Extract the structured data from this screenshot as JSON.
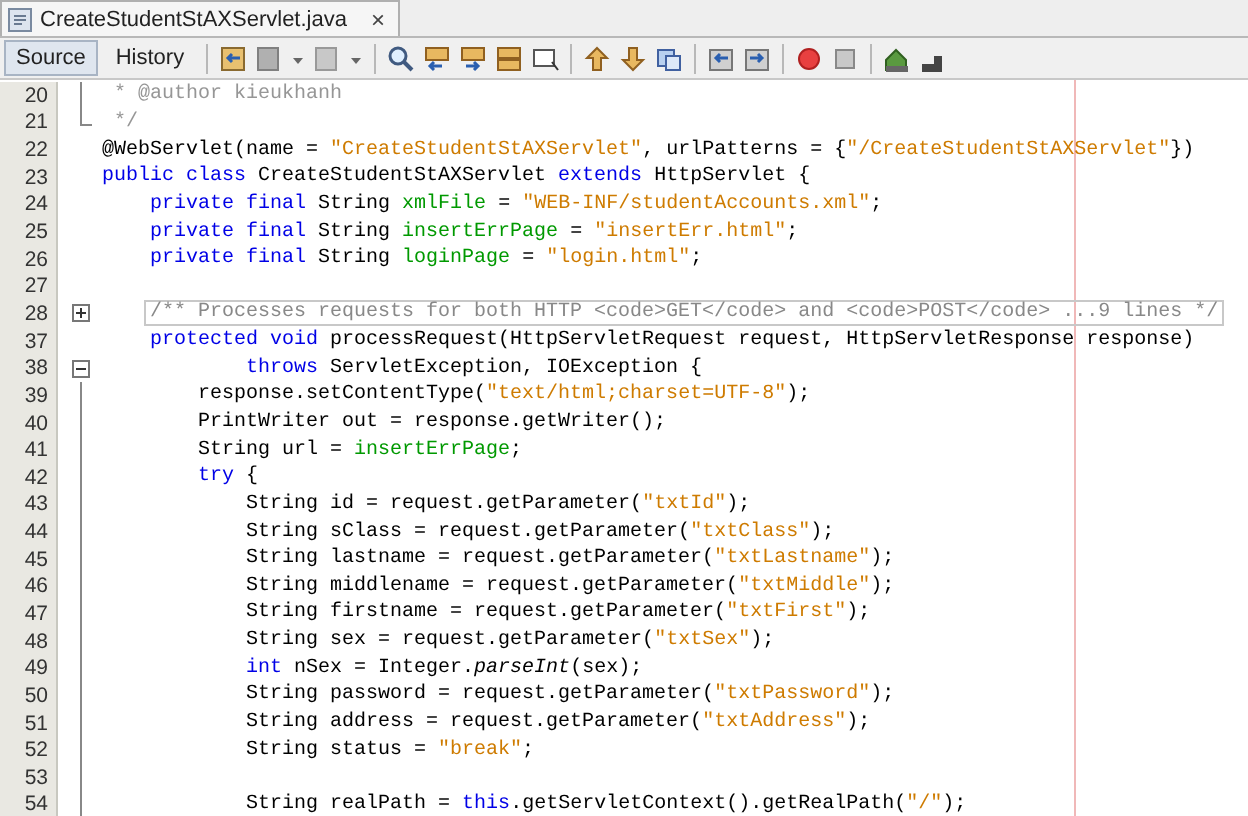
{
  "file_tab": {
    "title": "CreateStudentStAXServlet.java",
    "close": "×"
  },
  "view_tabs": [
    {
      "label": "Source",
      "selected": true
    },
    {
      "label": "History",
      "selected": false
    }
  ],
  "editor": {
    "lines": [
      {
        "number": "20",
        "fold_guide": true,
        "segments": [
          {
            "kind": "comment",
            "text": " * @author kieukhanh"
          }
        ]
      },
      {
        "number": "21",
        "fold_end": true,
        "segments": [
          {
            "kind": "comment",
            "text": " */"
          }
        ]
      },
      {
        "number": "22",
        "fold_guide": false,
        "segments": [
          {
            "kind": "plain",
            "text": "@WebServlet(name = "
          },
          {
            "kind": "string",
            "text": "\"CreateStudentStAXServlet\""
          },
          {
            "kind": "plain",
            "text": ", urlPatterns = {"
          },
          {
            "kind": "string",
            "text": "\"/CreateStudentStAXServlet\""
          },
          {
            "kind": "plain",
            "text": "})"
          }
        ]
      },
      {
        "number": "23",
        "fold_guide": false,
        "segments": [
          {
            "kind": "keyword",
            "text": "public class"
          },
          {
            "kind": "plain",
            "text": " CreateStudentStAXServlet "
          },
          {
            "kind": "keyword",
            "text": "extends"
          },
          {
            "kind": "plain",
            "text": " HttpServlet {"
          }
        ]
      },
      {
        "number": "24",
        "fold_guide": false,
        "segments": [
          {
            "kind": "keyword",
            "text": "    private final"
          },
          {
            "kind": "plain",
            "text": " String "
          },
          {
            "kind": "field",
            "text": "xmlFile"
          },
          {
            "kind": "plain",
            "text": " = "
          },
          {
            "kind": "string",
            "text": "\"WEB-INF/studentAccounts.xml\""
          },
          {
            "kind": "plain",
            "text": ";"
          }
        ]
      },
      {
        "number": "25",
        "fold_guide": false,
        "segments": [
          {
            "kind": "keyword",
            "text": "    private final"
          },
          {
            "kind": "plain",
            "text": " String "
          },
          {
            "kind": "field",
            "text": "insertErrPage"
          },
          {
            "kind": "plain",
            "text": " = "
          },
          {
            "kind": "string",
            "text": "\"insertErr.html\""
          },
          {
            "kind": "plain",
            "text": ";"
          }
        ]
      },
      {
        "number": "26",
        "fold_guide": false,
        "segments": [
          {
            "kind": "keyword",
            "text": "    private final"
          },
          {
            "kind": "plain",
            "text": " String "
          },
          {
            "kind": "field",
            "text": "loginPage"
          },
          {
            "kind": "plain",
            "text": " = "
          },
          {
            "kind": "string",
            "text": "\"login.html\""
          },
          {
            "kind": "plain",
            "text": ";"
          }
        ]
      },
      {
        "number": "27",
        "fold_guide": false
      },
      {
        "number": "28",
        "expanded": false,
        "segments": [
          {
            "kind": "folded",
            "text": "    /** Processes requests for both HTTP <code>GET</code> and <code>POST</code> ...9 lines */"
          }
        ]
      },
      {
        "number": "37",
        "fold_guide": false,
        "segments": [
          {
            "kind": "keyword",
            "text": "    protected void"
          },
          {
            "kind": "plain",
            "text": " processRequest(HttpServletRequest request, HttpServletResponse response)"
          }
        ]
      },
      {
        "number": "38",
        "expanded": true,
        "segments": [
          {
            "kind": "keyword",
            "text": "            throws"
          },
          {
            "kind": "plain",
            "text": " ServletException, IOException {"
          }
        ]
      },
      {
        "number": "39",
        "fold_guide": true,
        "segments": [
          {
            "kind": "plain",
            "text": "        response.setContentType("
          },
          {
            "kind": "string",
            "text": "\"text/html;charset=UTF-8\""
          },
          {
            "kind": "plain",
            "text": ");"
          }
        ]
      },
      {
        "number": "40",
        "fold_guide": true,
        "segments": [
          {
            "kind": "plain",
            "text": "        PrintWriter out = response.getWriter();"
          }
        ]
      },
      {
        "number": "41",
        "fold_guide": true,
        "segments": [
          {
            "kind": "plain",
            "text": "        String url = "
          },
          {
            "kind": "field",
            "text": "insertErrPage"
          },
          {
            "kind": "plain",
            "text": ";"
          }
        ]
      },
      {
        "number": "42",
        "fold_guide": true,
        "segments": [
          {
            "kind": "keyword",
            "text": "        try"
          },
          {
            "kind": "plain",
            "text": " {"
          }
        ]
      },
      {
        "number": "43",
        "fold_guide": true,
        "segments": [
          {
            "kind": "plain",
            "text": "            String id = request.getParameter("
          },
          {
            "kind": "string",
            "text": "\"txtId\""
          },
          {
            "kind": "plain",
            "text": ");"
          }
        ]
      },
      {
        "number": "44",
        "fold_guide": true,
        "segments": [
          {
            "kind": "plain",
            "text": "            String sClass = request.getParameter("
          },
          {
            "kind": "string",
            "text": "\"txtClass\""
          },
          {
            "kind": "plain",
            "text": ");"
          }
        ]
      },
      {
        "number": "45",
        "fold_guide": true,
        "segments": [
          {
            "kind": "plain",
            "text": "            String lastname = request.getParameter("
          },
          {
            "kind": "string",
            "text": "\"txtLastname\""
          },
          {
            "kind": "plain",
            "text": ");"
          }
        ]
      },
      {
        "number": "46",
        "fold_guide": true,
        "segments": [
          {
            "kind": "plain",
            "text": "            String middlename = request.getParameter("
          },
          {
            "kind": "string",
            "text": "\"txtMiddle\""
          },
          {
            "kind": "plain",
            "text": ");"
          }
        ]
      },
      {
        "number": "47",
        "fold_guide": true,
        "segments": [
          {
            "kind": "plain",
            "text": "            String firstname = request.getParameter("
          },
          {
            "kind": "string",
            "text": "\"txtFirst\""
          },
          {
            "kind": "plain",
            "text": ");"
          }
        ]
      },
      {
        "number": "48",
        "fold_guide": true,
        "segments": [
          {
            "kind": "plain",
            "text": "            String sex = request.getParameter("
          },
          {
            "kind": "string",
            "text": "\"txtSex\""
          },
          {
            "kind": "plain",
            "text": ");"
          }
        ]
      },
      {
        "number": "49",
        "fold_guide": true,
        "segments": [
          {
            "kind": "keyword",
            "text": "            int"
          },
          {
            "kind": "plain",
            "text": " nSex = Integer."
          },
          {
            "kind": "italic",
            "text": "parseInt"
          },
          {
            "kind": "plain",
            "text": "(sex);"
          }
        ]
      },
      {
        "number": "50",
        "fold_guide": true,
        "segments": [
          {
            "kind": "plain",
            "text": "            String password = request.getParameter("
          },
          {
            "kind": "string",
            "text": "\"txtPassword\""
          },
          {
            "kind": "plain",
            "text": ");"
          }
        ]
      },
      {
        "number": "51",
        "fold_guide": true,
        "segments": [
          {
            "kind": "plain",
            "text": "            String address = request.getParameter("
          },
          {
            "kind": "string",
            "text": "\"txtAddress\""
          },
          {
            "kind": "plain",
            "text": ");"
          }
        ]
      },
      {
        "number": "52",
        "fold_guide": true,
        "segments": [
          {
            "kind": "plain",
            "text": "            String status = "
          },
          {
            "kind": "string",
            "text": "\"break\""
          },
          {
            "kind": "plain",
            "text": ";"
          }
        ]
      },
      {
        "number": "53",
        "fold_guide": true
      },
      {
        "number": "54",
        "fold_guide": true,
        "segments": [
          {
            "kind": "plain",
            "text": "            String realPath = "
          },
          {
            "kind": "keyword",
            "text": "this"
          },
          {
            "kind": "plain",
            "text": ".getServletContext().getRealPath("
          },
          {
            "kind": "string",
            "text": "\"/\""
          },
          {
            "kind": "plain",
            "text": ");"
          }
        ]
      }
    ]
  }
}
